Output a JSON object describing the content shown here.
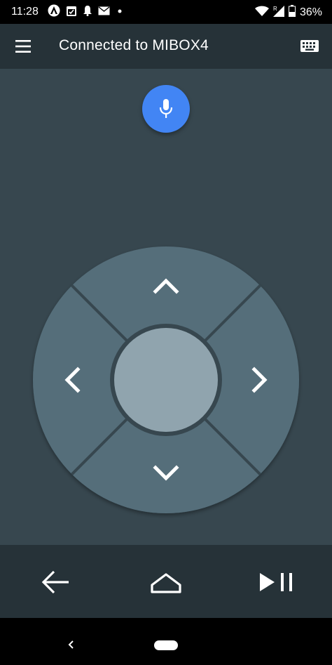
{
  "status_bar": {
    "time": "11:28",
    "battery": "36%",
    "icons": [
      "android-auto-icon",
      "calendar-icon",
      "bell-icon",
      "email-icon",
      "dot-icon",
      "wifi-icon",
      "signal-icon",
      "battery-icon"
    ]
  },
  "app_bar": {
    "title": "Connected to MIBOX4",
    "icons": [
      "menu-icon",
      "keyboard-icon"
    ]
  },
  "remote": {
    "mic_icon": "microphone-icon",
    "dpad_icons": [
      "chevron-up-icon",
      "chevron-left-icon",
      "chevron-right-icon",
      "chevron-down-icon"
    ],
    "accent_color": "#4285f4"
  },
  "bottom_controls": {
    "icons": [
      "back-arrow-icon",
      "home-icon",
      "play-pause-icon"
    ]
  },
  "nav_bar": {
    "icons": [
      "nav-back-icon",
      "nav-home-pill"
    ]
  }
}
